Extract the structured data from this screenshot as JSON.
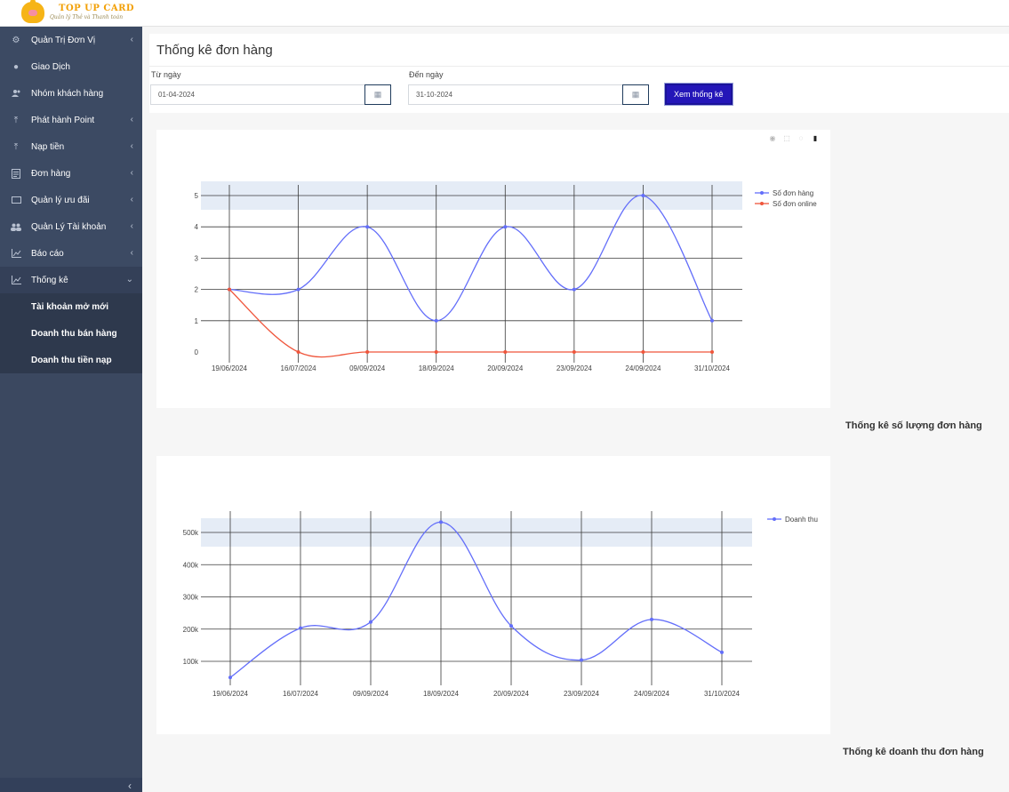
{
  "brand": {
    "title": "TOP UP CARD",
    "subtitle": "Quản lý Thẻ và Thanh toán"
  },
  "sidebar": {
    "items": [
      {
        "label": "Quản Trị Đơn Vị",
        "icon": "gear-icon",
        "chevron": "‹"
      },
      {
        "label": "Giao Dịch",
        "icon": "coins-icon",
        "chevron": ""
      },
      {
        "label": "Nhóm khách hàng",
        "icon": "users-icon",
        "chevron": ""
      },
      {
        "label": "Phát hành Point",
        "icon": "upload-icon",
        "chevron": "‹"
      },
      {
        "label": "Nạp tiền",
        "icon": "upload-icon",
        "chevron": "‹"
      },
      {
        "label": "Đơn hàng",
        "icon": "document-icon",
        "chevron": "‹"
      },
      {
        "label": "Quản lý ưu đãi",
        "icon": "ticket-icon",
        "chevron": "‹"
      },
      {
        "label": "Quản Lý Tài khoản",
        "icon": "user-group-icon",
        "chevron": "‹"
      },
      {
        "label": "Báo cáo",
        "icon": "chart-line-icon",
        "chevron": "‹"
      },
      {
        "label": "Thống kê",
        "icon": "chart-line-icon",
        "chevron": "⌄"
      }
    ],
    "subitems": [
      {
        "label": "Tài khoản mở mới"
      },
      {
        "label": "Doanh thu bán hàng"
      },
      {
        "label": "Doanh thu tiền nạp"
      }
    ],
    "collapse": "‹"
  },
  "page": {
    "title": "Thống kê đơn hàng"
  },
  "filter": {
    "from_label": "Từ ngày",
    "from_value": "01-04-2024",
    "to_label": "Đến ngày",
    "to_value": "31-10-2024",
    "submit_label": "Xem thống kê"
  },
  "modebar": {
    "camera": "◉",
    "select": "⬚",
    "lasso": "◌",
    "bars": "▮"
  },
  "captions": {
    "orders": "Thống kê số lượng đơn hàng",
    "revenue": "Thống kê doanh thu đơn hàng"
  },
  "chart_data": [
    {
      "type": "line",
      "x": [
        "19/06/2024",
        "16/07/2024",
        "09/09/2024",
        "18/09/2024",
        "20/09/2024",
        "23/09/2024",
        "24/09/2024",
        "31/10/2024"
      ],
      "series": [
        {
          "name": "Số đơn hàng",
          "values": [
            2,
            2,
            4,
            1,
            4,
            2,
            5,
            1
          ],
          "color": "#636efa"
        },
        {
          "name": "Số đơn online",
          "values": [
            2,
            0,
            0,
            0,
            0,
            0,
            0,
            0
          ],
          "color": "#ef553b"
        }
      ],
      "yticks": [
        "0",
        "1",
        "2",
        "3",
        "4",
        "5"
      ],
      "ylim": [
        0,
        5
      ],
      "grid": true,
      "legend": "top-right"
    },
    {
      "type": "line",
      "x": [
        "19/06/2024",
        "16/07/2024",
        "09/09/2024",
        "18/09/2024",
        "20/09/2024",
        "23/09/2024",
        "24/09/2024",
        "31/10/2024"
      ],
      "series": [
        {
          "name": "Doanh thu",
          "values": [
            50000,
            203000,
            222000,
            532000,
            210000,
            104000,
            230000,
            128000
          ],
          "color": "#636efa"
        }
      ],
      "yticks": [
        "100k",
        "200k",
        "300k",
        "400k",
        "500k"
      ],
      "ylim": [
        100000,
        500000
      ],
      "grid": true,
      "legend": "top-right"
    }
  ]
}
